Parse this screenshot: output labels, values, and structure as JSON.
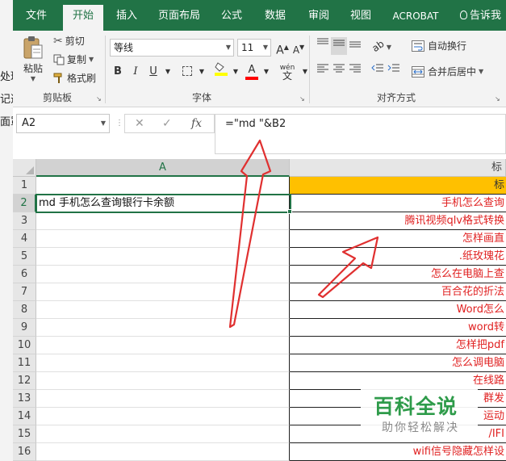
{
  "background_window": {
    "fragments": [
      "处理",
      "记选",
      "面罩"
    ]
  },
  "tabs": [
    "文件",
    "开始",
    "插入",
    "页面布局",
    "公式",
    "数据",
    "审阅",
    "视图",
    "ACROBAT",
    "告诉我"
  ],
  "clipboard": {
    "paste_label": "粘贴",
    "cut_label": "剪切",
    "copy_label": "复制",
    "format_painter_label": "格式刷",
    "group_label": "剪贴板"
  },
  "font": {
    "name": "等线",
    "size": "11",
    "grow_label": "A",
    "shrink_label": "A",
    "bold_label": "B",
    "italic_label": "I",
    "underline_label": "U",
    "font_color_label": "A",
    "phonetic_label": "wén",
    "phonetic_sub": "文",
    "group_label": "字体",
    "highlight_color": "#ffff00",
    "font_color": "#ff0000"
  },
  "alignment": {
    "wrap_label": "自动换行",
    "merge_label": "合并后居中",
    "group_label": "对齐方式"
  },
  "formula_bar": {
    "name_box": "A2",
    "cancel_label": "✕",
    "enter_label": "✓",
    "fx_label": "fx",
    "formula": "=\"md \"&B2"
  },
  "grid": {
    "col_a": "A",
    "col_b": "标",
    "rows": [
      "1",
      "2",
      "3",
      "4",
      "5",
      "6",
      "7",
      "8",
      "9",
      "10",
      "11",
      "12",
      "13",
      "14",
      "15",
      "16"
    ],
    "col_a_values": [
      "",
      "md 手机怎么查询银行卡余额"
    ],
    "col_b_header": "标",
    "col_b_values": [
      "手机怎么查询",
      "腾讯视频qlv格式转换",
      "怎样画直",
      ".纸玫瑰花",
      "怎么在电脑上查",
      "百合花的折法",
      "Word怎么",
      "word转",
      "怎样把pdf",
      "怎么调电脑",
      "在线路",
      "群发",
      "运动",
      "/IFI",
      "wifi信号隐藏怎样设"
    ]
  },
  "watermark": {
    "title": "百科全说",
    "subtitle": "助你轻松解决"
  },
  "colors": {
    "ribbon_green": "#217346",
    "header_fill": "#ffc000",
    "red_text": "#e02020",
    "arrow_red": "#e03030"
  }
}
